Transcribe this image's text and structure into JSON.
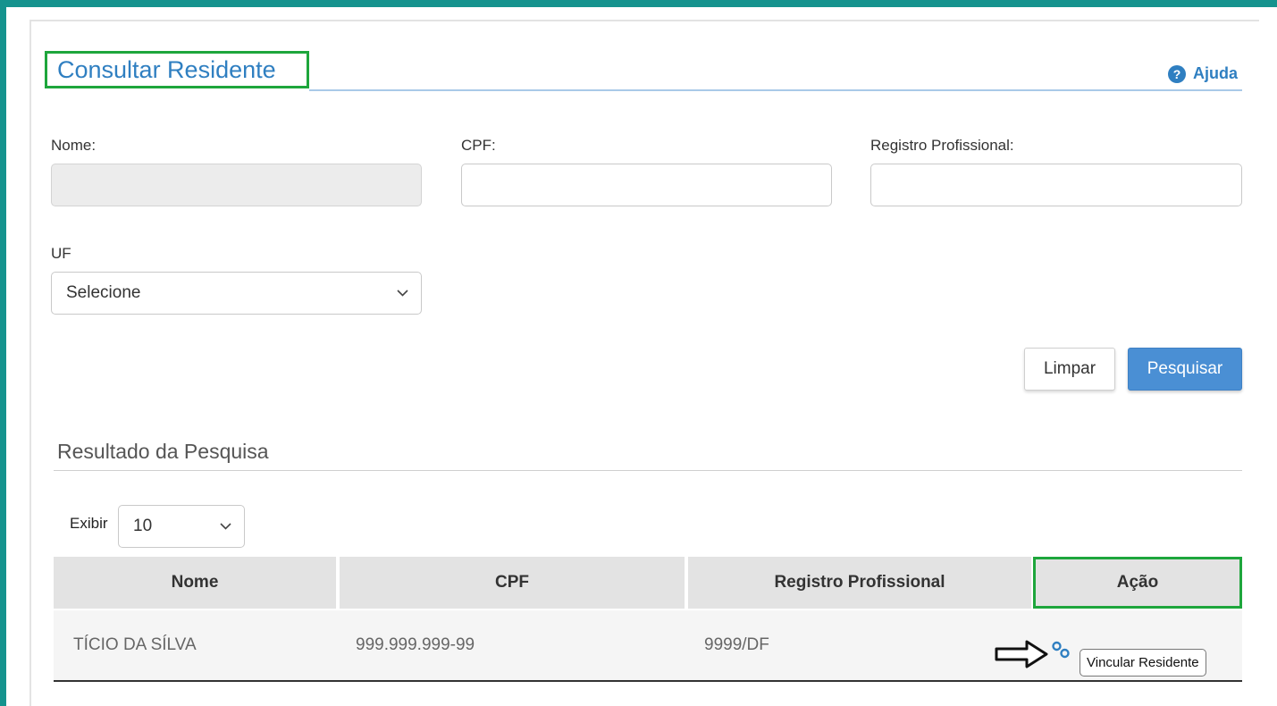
{
  "page": {
    "title": "Consultar Residente",
    "help_label": "Ajuda"
  },
  "form": {
    "nome_label": "Nome:",
    "nome_value": "",
    "cpf_label": "CPF:",
    "cpf_value": "",
    "registro_label": "Registro Profissional:",
    "registro_value": "",
    "uf_label": "UF",
    "uf_selected": "Selecione",
    "clear_button": "Limpar",
    "search_button": "Pesquisar"
  },
  "results": {
    "title": "Resultado da Pesquisa",
    "show_label": "Exibir",
    "page_size": "10",
    "columns": [
      "Nome",
      "CPF",
      "Registro Profissional",
      "Ação"
    ],
    "rows": [
      {
        "nome": "TÍCIO DA SÍLVA",
        "cpf": "999.999.999-99",
        "registro": "9999/DF"
      }
    ],
    "action_tooltip": "Vincular Residente"
  },
  "colors": {
    "frame": "#15938e",
    "primary": "#2f7fc1",
    "highlight_box": "#1ea63c",
    "search_button": "#4a8fd4"
  },
  "icons": {
    "help": "question-circle-icon",
    "action": "link-icon",
    "annotation": "arrow-right-icon"
  }
}
